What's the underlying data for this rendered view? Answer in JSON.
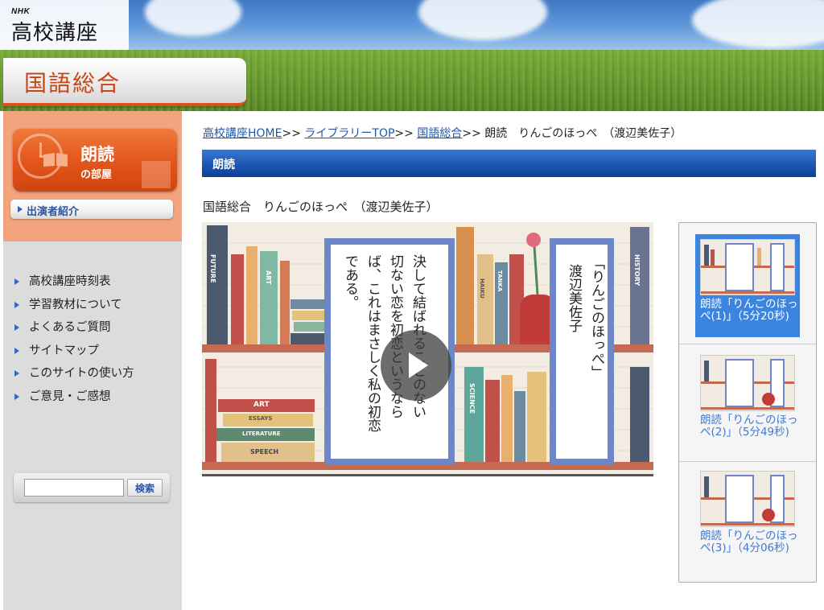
{
  "header": {
    "logo_brand": "NHK",
    "logo_title": "高校講座",
    "subject_title": "国語総合"
  },
  "sidebar": {
    "room_title": "朗読",
    "room_subtitle": "の部屋",
    "cast_link": "出演者紹介",
    "links": [
      "高校講座時刻表",
      "学習教材について",
      "よくあるご質問",
      "サイトマップ",
      "このサイトの使い方",
      "ご意見・ご感想"
    ],
    "search": {
      "value": "",
      "button_label": "検索"
    }
  },
  "breadcrumb": {
    "items": [
      "高校講座HOME",
      "ライブラリーTOP",
      "国語総合"
    ],
    "separator": ">>",
    "current": "朗読　りんごのほっぺ　（渡辺美佐子）"
  },
  "section_bar": "朗読",
  "content_title": "国語総合　りんごのほっぺ　（渡辺美佐子）",
  "video": {
    "card_title": "「りんごのほっぺ」",
    "card_author": "渡辺美佐子",
    "card_text_lines": [
      "決して結ばれることのない",
      "切ない恋を初恋というなら",
      "ば、これはまさしく私の初恋",
      "である。"
    ],
    "book_spines": [
      "FUTURE",
      "ART",
      "HISTORY",
      "TANKA",
      "HAIKU",
      "SCIENCE",
      "ART",
      "ESSAYS",
      "LITERATURE",
      "SPEECH"
    ]
  },
  "playlist": [
    {
      "label": "朗読「りんごのほっぺ(1)」（5分20秒)",
      "active": true
    },
    {
      "label": "朗読「りんごのほっぺ(2)」（5分49秒)",
      "active": false
    },
    {
      "label": "朗読「りんごのほっぺ(3)」（4分06秒)",
      "active": false
    }
  ],
  "colors": {
    "accent_orange": "#e2541a",
    "bar_blue": "#1d57b4",
    "link_blue": "#2255aa"
  }
}
